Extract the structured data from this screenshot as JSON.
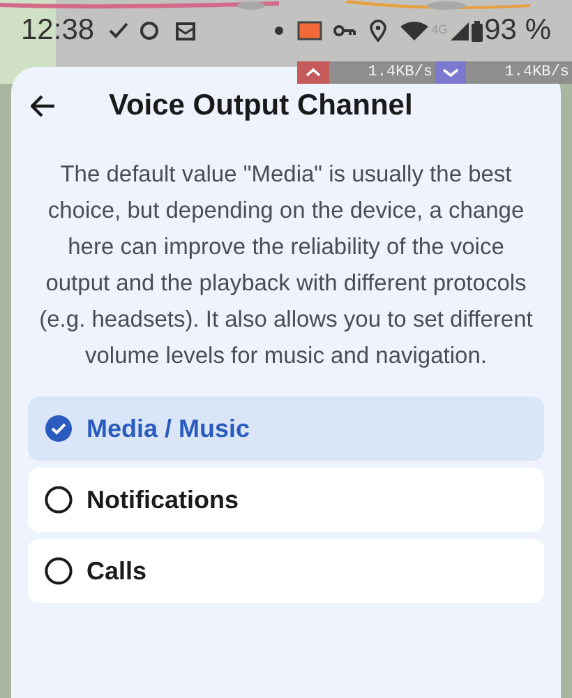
{
  "status_bar": {
    "time": "12:38",
    "network": "4G",
    "battery": "93 %"
  },
  "speed_overlay": {
    "upload": "1.4KB/s",
    "download": "1.4KB/s"
  },
  "dialog": {
    "title": "Voice Output Channel",
    "description": "The default value \"Media\" is usually the best choice, but depending on the device, a change here can improve the reliability of the voice output and the playback with different protocols (e.g. headsets). It also allows you to set different volume levels for music and navigation.",
    "options": [
      {
        "label": "Media / Music",
        "selected": true
      },
      {
        "label": "Notifications",
        "selected": false
      },
      {
        "label": "Calls",
        "selected": false
      }
    ]
  }
}
